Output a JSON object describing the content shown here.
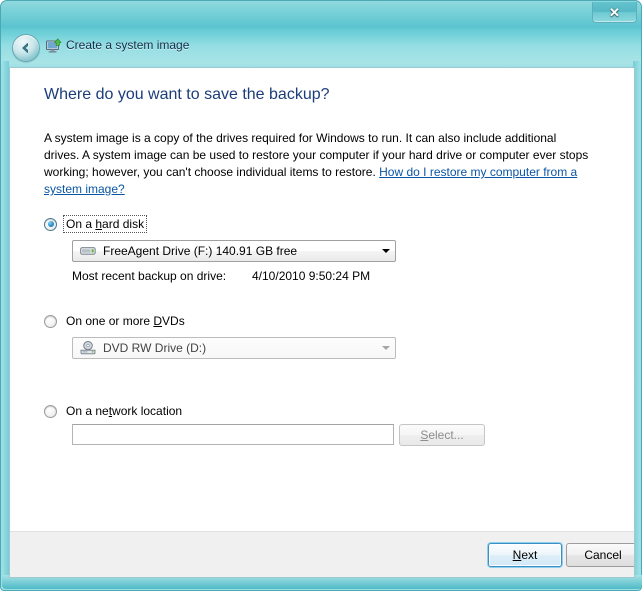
{
  "window": {
    "title": "Create a system image",
    "close_label": "✕",
    "back_label": "Back",
    "app_icon": "system-image-icon"
  },
  "page": {
    "heading": "Where do you want to save the backup?",
    "intro_part1": "A system image is a copy of the drives required for Windows to run. It can also include additional drives. A system image can be used to restore your computer if your hard drive or computer ever stops working; however, you can't choose individual items to restore. ",
    "intro_link": "How do I restore my computer from a system image?"
  },
  "options": {
    "hard_disk": {
      "label_pre": "On a ",
      "label_accel": "h",
      "label_post": "ard disk",
      "selected": true,
      "focused": true,
      "combo_value": "FreeAgent Drive (F:)  140.91 GB free",
      "combo_icon": "hard-drive-icon",
      "recent_backup_label": "Most recent backup on drive:",
      "recent_backup_value": "4/10/2010 9:50:24 PM"
    },
    "dvd": {
      "label_pre": "On one or more ",
      "label_accel": "D",
      "label_post": "VDs",
      "selected": false,
      "combo_value": "DVD RW Drive (D:)",
      "combo_icon": "dvd-drive-icon",
      "disabled": true
    },
    "network": {
      "label_pre": "On a ne",
      "label_accel": "t",
      "label_post": "work location",
      "selected": false,
      "input_value": "",
      "input_placeholder": "",
      "select_button_pre": "",
      "select_button_accel": "S",
      "select_button_post": "elect...",
      "select_button_disabled": true
    }
  },
  "footer": {
    "next_pre": "",
    "next_accel": "N",
    "next_post": "ext",
    "cancel_label": "Cancel"
  },
  "colors": {
    "frame": "#84d6dd",
    "heading": "#1b3d7a",
    "link": "#0b56a4",
    "default_button_border": "#3c8fc4",
    "footer_bg": "#f0f0f0"
  }
}
